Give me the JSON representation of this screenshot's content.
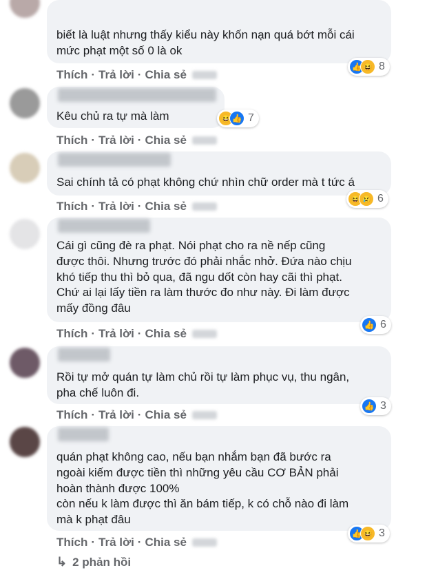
{
  "actions": {
    "like": "Thích",
    "reply": "Trả lời",
    "share": "Chia sẻ",
    "separator": "·"
  },
  "comments": [
    {
      "text": "biết là luật nhưng thấy kiểu này khốn nạn quá bớt mỗi cái\nmức phạt một số 0 là ok",
      "reactions": [
        "like-icon",
        "haha-icon"
      ],
      "count": "8"
    },
    {
      "text": "Kêu chủ ra tự mà làm",
      "reactions": [
        "haha-icon",
        "like-icon"
      ],
      "count": "7"
    },
    {
      "text": "Sai chính tả có phạt không chứ nhìn chữ order mà t tức á",
      "reactions": [
        "haha-icon",
        "sad-icon"
      ],
      "count": "6"
    },
    {
      "text": "Cái gì cũng đè ra phạt. Nói phạt cho ra nề nếp cũng\nđược thôi. Nhưng trước đó phải nhắc nhở. Đứa nào chịu\nkhó tiếp thu thì bỏ qua, đã ngu dốt còn hay cãi thì phạt.\nChứ ai lại lấy tiền ra làm thước đo như này. Đi làm được\nmấy đồng đâu",
      "reactions": [
        "like-icon"
      ],
      "count": "6"
    },
    {
      "text": "Rồi tự mở quán tự làm chủ rồi tự làm phục vụ, thu ngân,\npha chế luôn đi.",
      "reactions": [
        "like-icon"
      ],
      "count": "3"
    },
    {
      "text": "quán phạt không cao, nếu bạn nhắm bạn đã bước ra\nngoài kiếm được tiền thì những yêu cầu CƠ BẢN phải\nhoàn thành được 100%\ncòn nếu k làm được thì ăn bám tiếp, k có chỗ nào đi làm\nmà k phạt đâu",
      "reactions": [
        "like-icon",
        "haha-icon"
      ],
      "count": "3"
    }
  ],
  "replies_link": "2 phản hồi",
  "icons": {
    "like": "👍",
    "haha": "😆",
    "sad": "😢",
    "reply_arrow": "↳"
  },
  "colors": {
    "bubble": "#f0f2f5",
    "like": "#1877f2",
    "secondary_text": "#65676b"
  }
}
